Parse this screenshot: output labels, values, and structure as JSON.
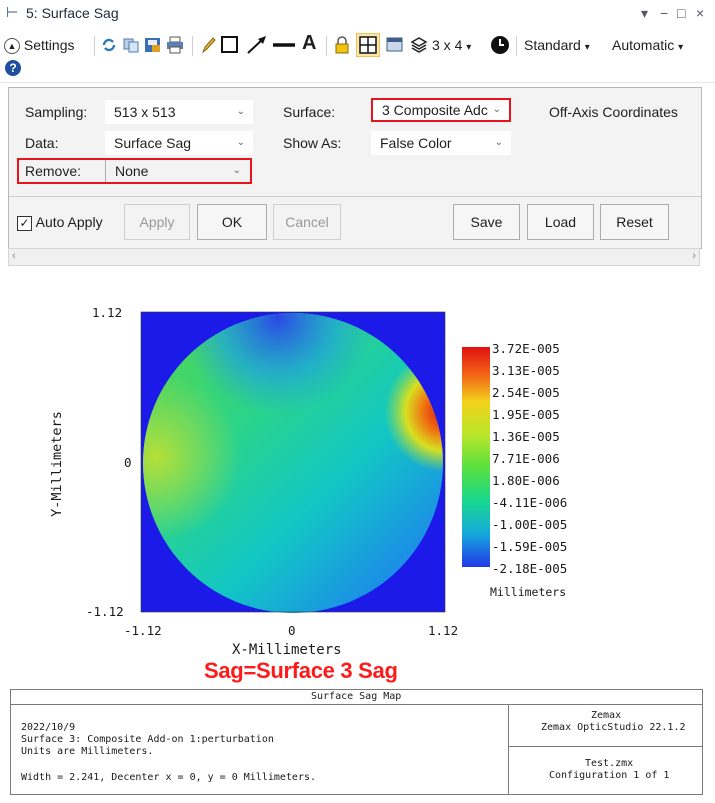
{
  "window": {
    "title": "5: Surface Sag",
    "controls": [
      "▾",
      "−",
      "□",
      "×"
    ]
  },
  "toolbar": {
    "settings_label": "Settings",
    "grid_label": "3 x 4",
    "grid_arrow": "▾",
    "standard_label": "Standard",
    "standard_arrow": "▾",
    "automatic_label": "Automatic",
    "automatic_arrow": "▾",
    "icons": [
      "refresh-icon",
      "copy-icon",
      "save-image-icon",
      "print-icon",
      "pencil-icon",
      "rectangle-icon",
      "arrow-icon",
      "line-icon",
      "text-icon",
      "lock-icon",
      "layout-icon",
      "window-icon",
      "layers-icon",
      "clock-icon",
      "help-icon"
    ]
  },
  "settings": {
    "sampling_label": "Sampling:",
    "sampling_value": "513 x 513",
    "surface_label": "Surface:",
    "surface_value": "3 Composite Adc",
    "off_axis_label": "Off-Axis Coordinates",
    "data_label": "Data:",
    "data_value": "Surface Sag",
    "show_as_label": "Show As:",
    "show_as_value": "False Color",
    "remove_label": "Remove:",
    "remove_value": "None",
    "auto_apply_label": "Auto Apply",
    "auto_apply_checked": true,
    "buttons": {
      "apply": "Apply",
      "ok": "OK",
      "cancel": "Cancel",
      "save": "Save",
      "load": "Load",
      "reset": "Reset"
    },
    "highlight_color": "#e8141c"
  },
  "plot": {
    "y_label": "Y-Millimeters",
    "x_label": "X-Millimeters",
    "y_ticks": [
      "1.12",
      "0",
      "-1.12"
    ],
    "x_ticks": [
      "-1.12",
      "0",
      "1.12"
    ],
    "colorbar_labels": [
      "3.72E-005",
      "3.13E-005",
      "2.54E-005",
      "1.95E-005",
      "1.36E-005",
      "7.71E-006",
      "1.80E-006",
      "-4.11E-006",
      "-1.00E-005",
      "-1.59E-005",
      "-2.18E-005"
    ],
    "colorbar_unit": "Millimeters",
    "annotation": "Sag=Surface 3 Sag",
    "annotation_color": "#ff1a1a"
  },
  "footer": {
    "header": "Surface Sag Map",
    "date": "2022/10/9",
    "line1": "Surface 3: Composite Add-on 1:perturbation",
    "line2": "Units are Millimeters.",
    "line3": "Width = 2.241, Decenter x = 0, y = 0 Millimeters.",
    "vendor": "Zemax",
    "product": "Zemax OpticStudio 22.1.2",
    "file": "Test.zmx",
    "config": "Configuration 1 of 1"
  }
}
